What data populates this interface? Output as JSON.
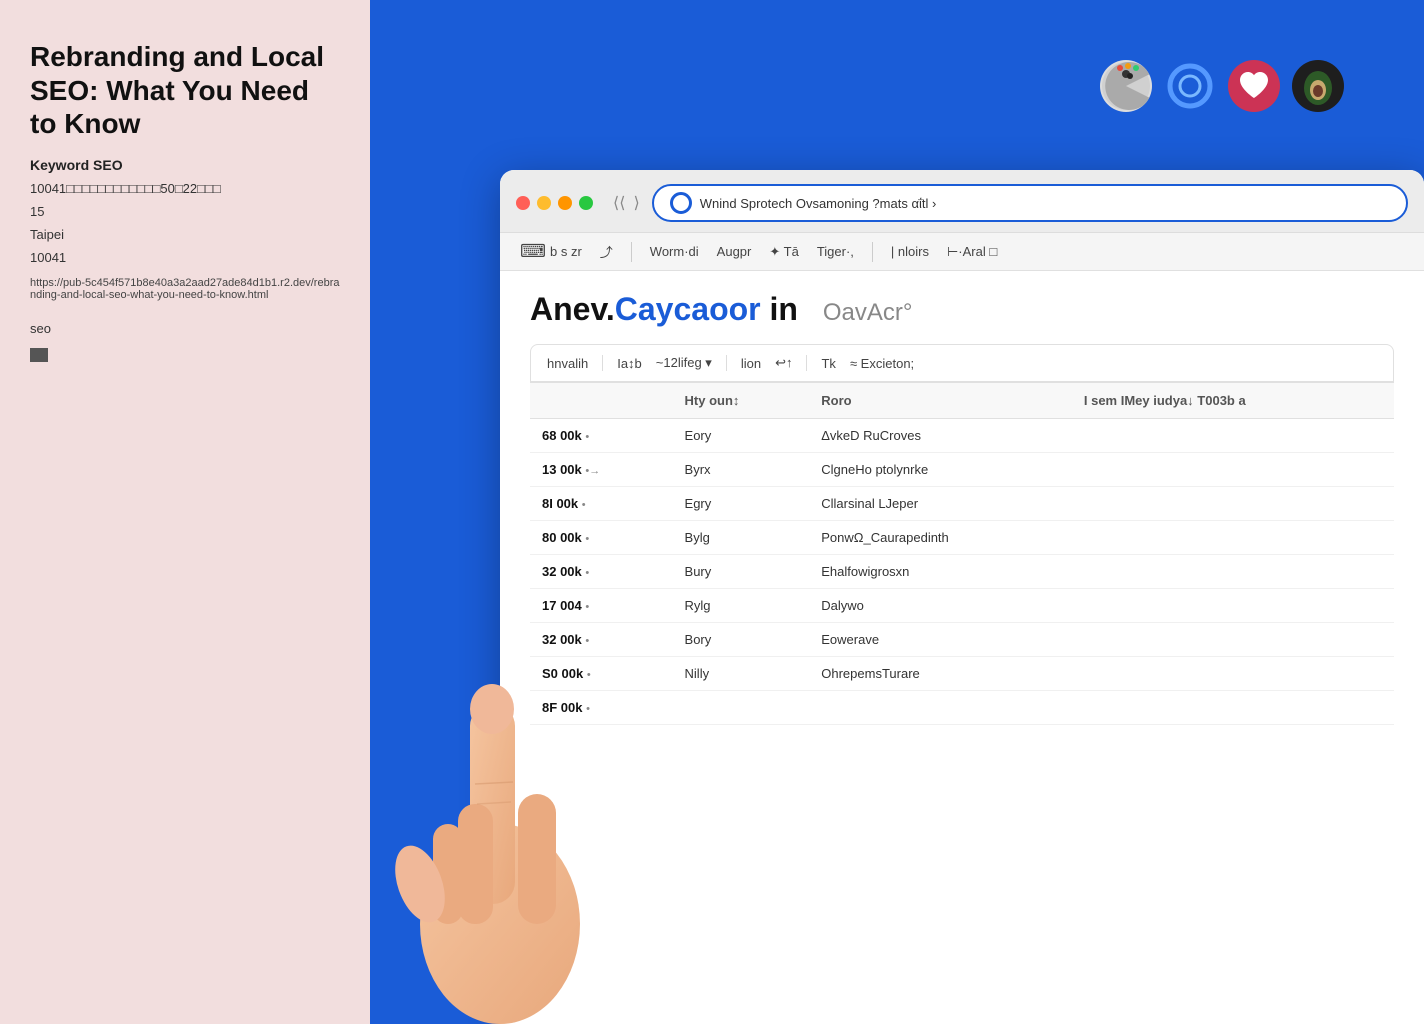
{
  "sidebar": {
    "title": "Rebranding and Local SEO: What You Need to Know",
    "meta_label": "Keyword SEO",
    "meta_line1": "10041□□□□□□□□□□□□50□22□□□",
    "meta_line2": "15",
    "meta_city": "Taipei",
    "meta_zip": "10041",
    "meta_url": "https://pub-5c454f571b8e40a3a2aad27ade84d1b1.r2.dev/rebranding-and-local-seo-what-you-need-to-know.html",
    "tag_label": "seo",
    "tag_icon": "▬"
  },
  "browser": {
    "address_bar_text": "Wnind Sprotech Ovsamoning ?mats αΐtl ›",
    "address_circle": true,
    "nav_back": "⟨",
    "nav_forward": "⟩",
    "toolbar_items": [
      {
        "icon": "⌨",
        "label": "b s zr"
      },
      {
        "icon": "⟳",
        "label": ""
      },
      {
        "label": "Worm·di"
      },
      {
        "label": "Augpr"
      },
      {
        "label": "✦ Tā"
      },
      {
        "label": "Tiger·,"
      },
      {
        "label": "| nloirs"
      },
      {
        "label": "⊢·Aral"
      },
      {
        "label": "□"
      }
    ]
  },
  "page": {
    "heading_part1": "Anev.",
    "heading_part2": "Caycaoor",
    "heading_part3": " in",
    "heading_sub": "OavAcr°"
  },
  "table": {
    "toolbar_items": [
      {
        "label": "hnvalih"
      },
      {
        "label": "IaTb"
      },
      {
        "label": "~12lifeg ▾"
      },
      {
        "label": "lion"
      },
      {
        "label": "↩↑"
      },
      {
        "label": ""
      },
      {
        "label": "Tk"
      },
      {
        "label": "≈ Excieton;"
      }
    ],
    "headers": [
      "",
      "Hty oun↕",
      "Roro",
      "I sem IMey iudya↓ T003b a"
    ],
    "rows": [
      {
        "volume": "68 00k",
        "dot": "•",
        "col2": "Eory",
        "col3": "ΔvkeD RuCroves"
      },
      {
        "volume": "13 00k",
        "dot": "•→",
        "col2": "Byrx",
        "col3": "ClgneHo ptolynrke"
      },
      {
        "volume": "8I  00k",
        "dot": "•",
        "col2": "Egry",
        "col3": "Cllarsinal LJeper"
      },
      {
        "volume": "80 00k",
        "dot": "•",
        "col2": "Bylg",
        "col3": "PonwΩ_Caurapedinth"
      },
      {
        "volume": "32 00k",
        "dot": "•",
        "col2": "Bury",
        "col3": "Ehalfowigrosxn"
      },
      {
        "volume": "17 004",
        "dot": "•",
        "col2": "Rylg",
        "col3": "Dalywo"
      },
      {
        "volume": "32 00k",
        "dot": "•",
        "col2": "Bory",
        "col3": "Eowerave"
      },
      {
        "volume": "S0 00k",
        "dot": "•",
        "col2": "Nilly",
        "col3": "OhrepemsTurare"
      },
      {
        "volume": "8F 00k",
        "dot": "•",
        "col2": "",
        "col3": ""
      }
    ]
  },
  "mac_icons": [
    {
      "type": "pacman",
      "color": "#e0e0e0"
    },
    {
      "type": "ring",
      "color": "#1a5cd7"
    },
    {
      "type": "heart",
      "color": "#cc3355"
    },
    {
      "type": "avocado",
      "color": "#1e1e1e"
    }
  ]
}
